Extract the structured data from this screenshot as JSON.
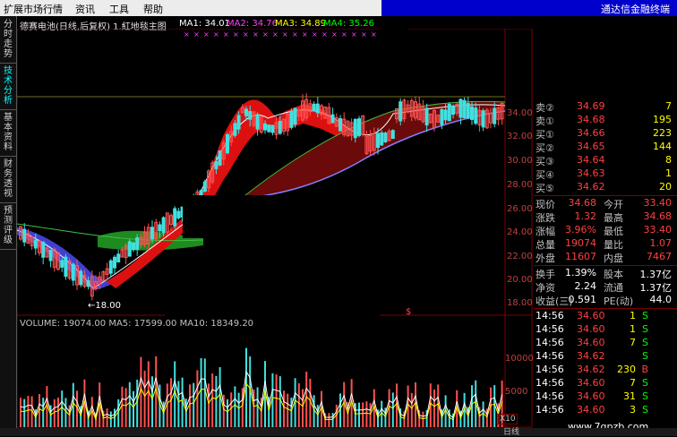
{
  "menu": {
    "items": [
      "扩展市场行情",
      "资讯",
      "工具",
      "帮助"
    ],
    "brand": "通达信金融终端"
  },
  "leftnav": [
    {
      "label": "分时走势",
      "active": false
    },
    {
      "label": "技术分析",
      "active": true
    },
    {
      "label": "基本资料",
      "active": false
    },
    {
      "label": "财务透视",
      "active": false
    },
    {
      "label": "预测评级",
      "active": false
    }
  ],
  "chart": {
    "title": "德赛电池(日线,后复权) 1.紅地毯主图",
    "ma": [
      {
        "label": "MA1: 34.01",
        "color": "#ffffff"
      },
      {
        "label": "MA2: 34.76",
        "color": "#ff40ff"
      },
      {
        "label": "MA3: 34.89",
        "color": "#ffff00"
      },
      {
        "label": "MA4: 35.26",
        "color": "#00ff00"
      }
    ],
    "price_ticks": [
      "34.00",
      "32.00",
      "30.00",
      "28.00",
      "26.00",
      "24.00",
      "22.00",
      "20.00",
      "18.00"
    ],
    "low_marker": "←18.00",
    "volume_label": "VOLUME: 19074.00  MA5: 17599.00  MA10: 18349.20",
    "volume_ticks": [
      "10000",
      "5000"
    ],
    "volume_unit": "X10",
    "period": "日线",
    "dollar": "$"
  },
  "chart_data": {
    "type": "candlestick",
    "title": "德赛电池(日线,后复权)",
    "y_range": [
      17.5,
      36.5
    ],
    "low_price": 18.0,
    "ma_values": {
      "MA1": 34.01,
      "MA2": 34.76,
      "MA3": 34.89,
      "MA4": 35.26
    },
    "volume": {
      "VOLUME": 19074.0,
      "MA5": 17599.0,
      "MA10": 18349.2
    }
  },
  "quote": {
    "orderbook": [
      {
        "label": "卖②",
        "price": "34.69",
        "vol": "7"
      },
      {
        "label": "卖①",
        "price": "34.68",
        "vol": "195"
      },
      {
        "label": "买①",
        "price": "34.66",
        "vol": "223"
      },
      {
        "label": "买②",
        "price": "34.65",
        "vol": "144"
      },
      {
        "label": "买③",
        "price": "34.64",
        "vol": "8"
      },
      {
        "label": "买④",
        "price": "34.63",
        "vol": "1"
      },
      {
        "label": "买⑤",
        "price": "34.62",
        "vol": "20"
      }
    ],
    "stats": [
      {
        "l1": "现价",
        "v1": "34.68",
        "l2": "今开",
        "v2": "33.40"
      },
      {
        "l1": "涨跌",
        "v1": "1.32",
        "l2": "最高",
        "v2": "34.68"
      },
      {
        "l1": "涨幅",
        "v1": "3.96%",
        "l2": "最低",
        "v2": "33.40"
      },
      {
        "l1": "总量",
        "v1": "19074",
        "l2": "量比",
        "v2": "1.07"
      },
      {
        "l1": "外盘",
        "v1": "11607",
        "l2": "内盘",
        "v2": "7467"
      }
    ],
    "stats2": [
      {
        "l1": "换手",
        "v1": "1.39%",
        "l2": "股本",
        "v2": "1.37亿"
      },
      {
        "l1": "净资",
        "v1": "2.24",
        "l2": "流通",
        "v2": "1.37亿"
      },
      {
        "l1": "收益(三)",
        "v1": "0.591",
        "l2": "PE(动)",
        "v2": "44.0"
      }
    ],
    "ticks": [
      {
        "time": "14:56",
        "price": "34.60",
        "vol": "1",
        "side": "S"
      },
      {
        "time": "14:56",
        "price": "34.60",
        "vol": "1",
        "side": "S"
      },
      {
        "time": "14:56",
        "price": "34.60",
        "vol": "7",
        "side": "S"
      },
      {
        "time": "14:56",
        "price": "34.62",
        "vol": "",
        "side": "S"
      },
      {
        "time": "14:56",
        "price": "34.62",
        "vol": "230",
        "side": "B"
      },
      {
        "time": "14:56",
        "price": "34.60",
        "vol": "7",
        "side": "S"
      },
      {
        "time": "14:56",
        "price": "34.60",
        "vol": "31",
        "side": "S"
      },
      {
        "time": "14:56",
        "price": "34.60",
        "vol": "3",
        "side": "S"
      }
    ]
  },
  "watermark": "www.7gpzb.com"
}
